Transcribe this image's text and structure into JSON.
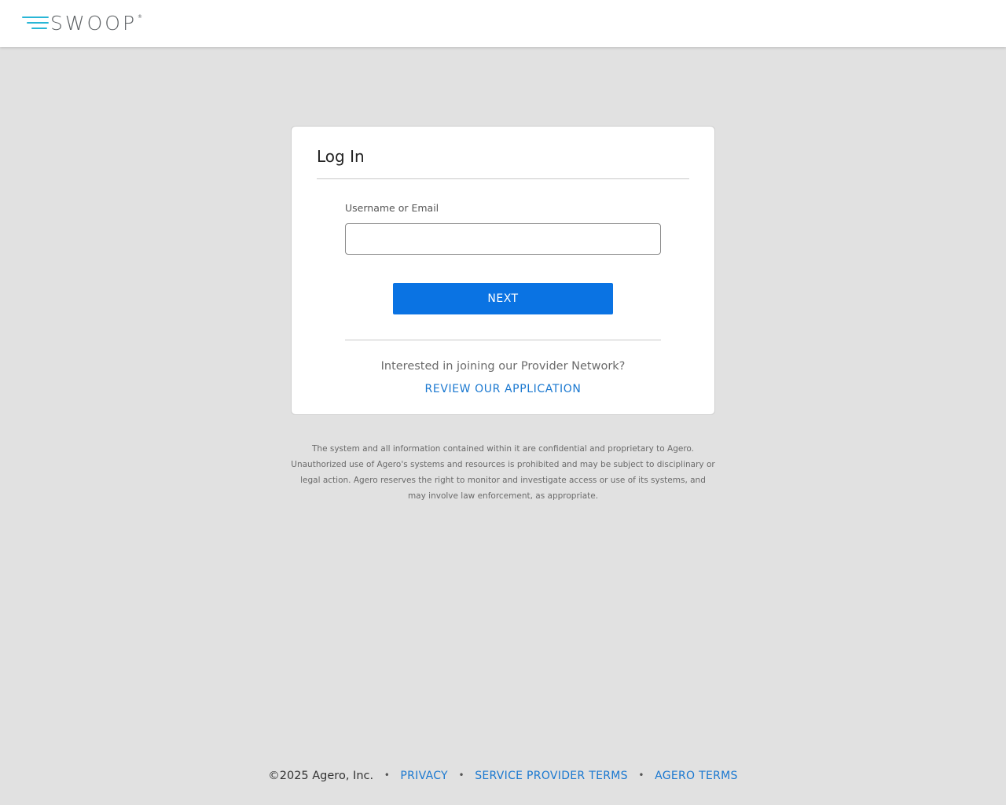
{
  "header": {
    "logo_text": "SWOOP",
    "logo_reg": "®"
  },
  "login": {
    "title": "Log In",
    "username_label": "Username or Email",
    "username_value": "",
    "username_placeholder": "",
    "next_label": "NEXT",
    "join_prompt": "Interested in joining our Provider Network?",
    "review_link": "REVIEW OUR APPLICATION"
  },
  "disclaimer": "The system and all information contained within it are confidential and proprietary to Agero. Unauthorized use of Agero's systems and resources is prohibited and may be subject to disciplinary or legal action. Agero reserves the right to monitor and investigate access or use of its systems, and may involve law enforcement, as appropriate.",
  "footer": {
    "copyright": "©2025 Agero, Inc.",
    "separator": "•",
    "links": {
      "privacy": "PRIVACY",
      "service_provider_terms": "SERVICE PROVIDER TERMS",
      "agero_terms": "AGERO TERMS"
    }
  },
  "colors": {
    "accent_blue": "#0a73e3",
    "link_blue": "#1a78d0",
    "logo_cyan": "#29b6d6",
    "background": "#e1e1e1"
  },
  "icons": {
    "logo_mark": "speed-lines-icon"
  }
}
